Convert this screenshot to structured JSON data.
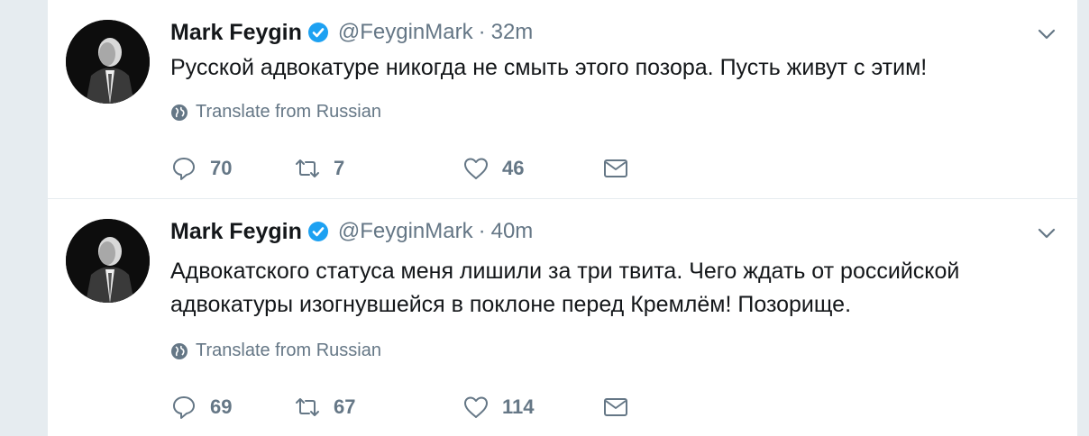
{
  "tweets": [
    {
      "name": "Mark Feygin",
      "handle": "@FeyginMark",
      "separator": "·",
      "time": "32m",
      "text": "Русской адвокатуре никогда не смыть этого позора. Пусть живут с этим!",
      "translate": "Translate from Russian",
      "replies": "70",
      "retweets": "7",
      "likes": "46"
    },
    {
      "name": "Mark Feygin",
      "handle": "@FeyginMark",
      "separator": "·",
      "time": "40m",
      "text": "Адвокатского статуса меня лишили за три твита. Чего ждать от российской адвокатуры изогнувшейся в поклоне перед Кремлём! Позорище.",
      "translate": "Translate from Russian",
      "replies": "69",
      "retweets": "67",
      "likes": "114"
    }
  ],
  "icons": {
    "verified": "verified-badge-icon",
    "chevron": "chevron-down-icon",
    "globe": "globe-icon",
    "reply": "reply-icon",
    "retweet": "retweet-icon",
    "like": "heart-icon",
    "message": "envelope-icon"
  },
  "colors": {
    "verified": "#1da1f2",
    "secondary_text": "#657786",
    "primary_text": "#14171a",
    "background": "#e6ecf0"
  }
}
